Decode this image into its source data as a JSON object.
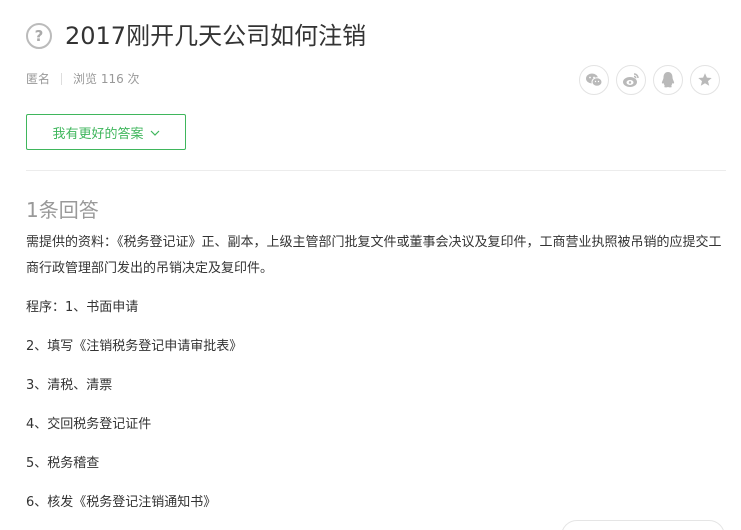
{
  "question": {
    "icon": "question-circle-icon",
    "title": "2017刚开几天公司如何注销"
  },
  "meta": {
    "author": "匿名",
    "views": "浏览 116 次"
  },
  "share": [
    {
      "name": "wechat-icon",
      "color": "#b9b9b9"
    },
    {
      "name": "weibo-icon",
      "color": "#b9b9b9"
    },
    {
      "name": "qq-icon",
      "color": "#b9b9b9"
    },
    {
      "name": "star-icon",
      "color": "#b9b9b9"
    }
  ],
  "answer_button": {
    "label": "我有更好的答案",
    "icon": "chevron-down-icon",
    "color": "#3fb65c"
  },
  "answers": {
    "count_label": "1条回答",
    "paragraphs": [
      "需提供的资料：《税务登记证》正、副本，上级主管部门批复文件或董事会决议及复印件，工商营业执照被吊销的应提交工商行政管理部门发出的吊销决定及复印件。",
      "程序：1、书面申请",
      "2、填写《注销税务登记申请审批表》",
      "3、清税、清票",
      "4、交回税务登记证件",
      "5、税务稽查",
      "6、核发《税务登记注销通知书》"
    ]
  }
}
